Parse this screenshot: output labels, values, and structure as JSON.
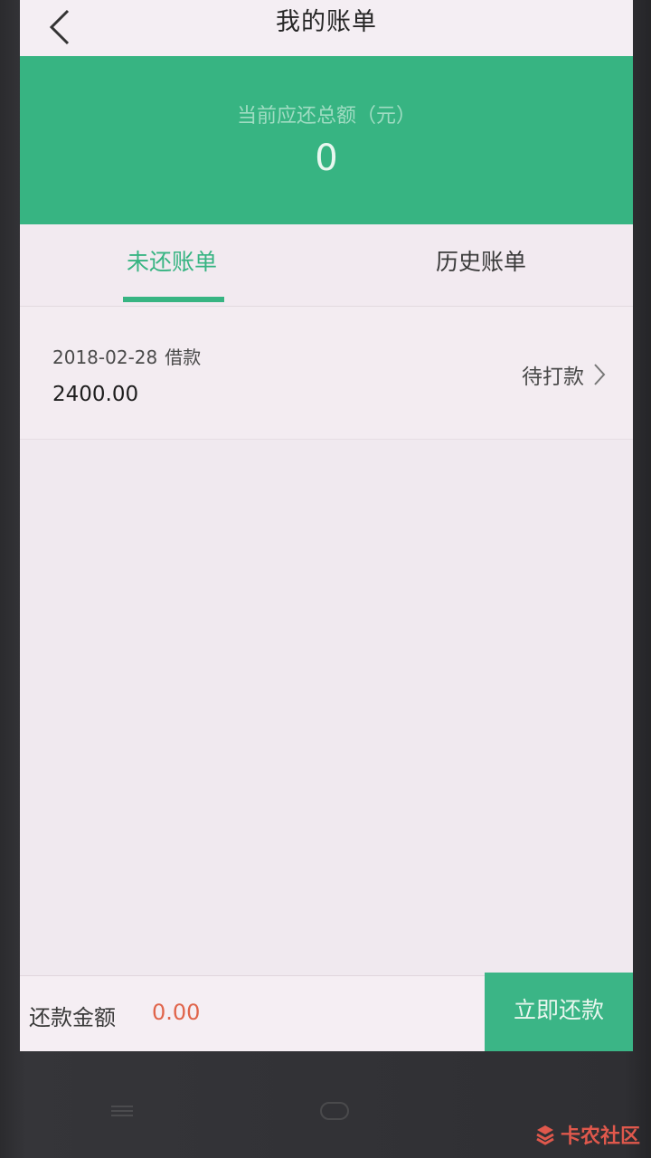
{
  "navbar": {
    "title": "我的账单",
    "back_icon": "chevron-left-icon"
  },
  "summary": {
    "label": "当前应还总额（元）",
    "amount": "0"
  },
  "tabs": [
    {
      "label": "未还账单",
      "active": true
    },
    {
      "label": "历史账单",
      "active": false
    }
  ],
  "bills": [
    {
      "date": "2018-02-28",
      "type": "借款",
      "amount": "2400.00",
      "status": "待打款"
    }
  ],
  "footer": {
    "pay_label": "还款金额",
    "pay_amount": "0.00",
    "pay_button": "立即还款"
  },
  "watermark": {
    "text": "卡农社区"
  },
  "colors": {
    "brand_green": "#37b482",
    "amount_red": "#e0644a"
  }
}
